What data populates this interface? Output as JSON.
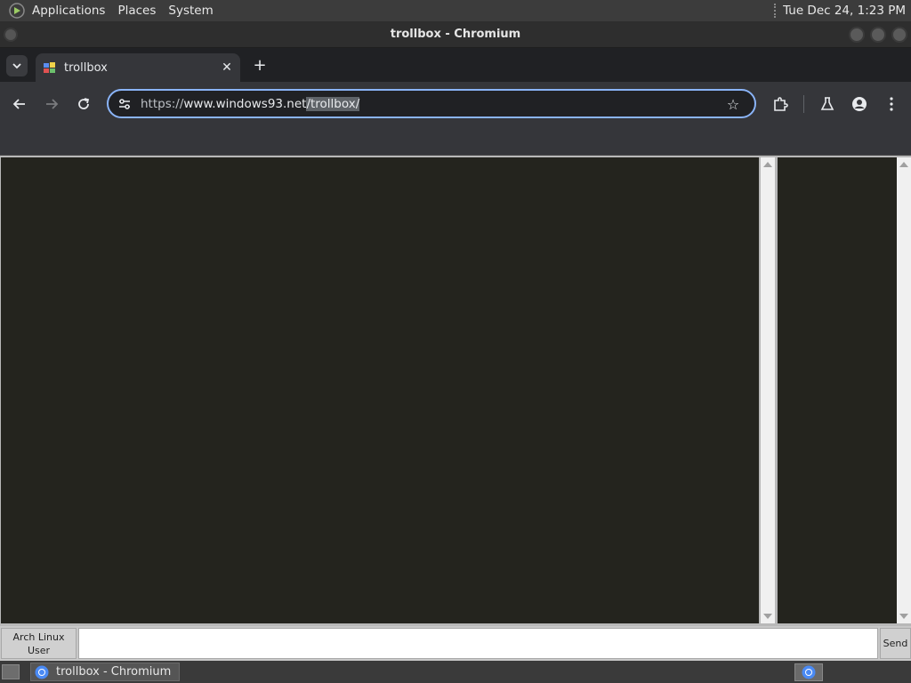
{
  "top_panel": {
    "menus": [
      "Applications",
      "Places",
      "System"
    ],
    "clock": "Tue Dec 24,  1:23 PM"
  },
  "window": {
    "title": "trollbox - Chromium"
  },
  "tabs": [
    {
      "label": "trollbox",
      "active": true
    }
  ],
  "toolbar": {
    "url_scheme": "https://",
    "url_host": "www.windows93.net",
    "url_path": "/trollbox/"
  },
  "page": {
    "nick_button": "Arch Linux User",
    "message_input_value": "",
    "send_label": "Send"
  },
  "taskbar": {
    "task_label": "trollbox - Chromium"
  },
  "icons": {
    "tab_search": "chevron-down-icon",
    "close_tab": "close-icon",
    "new_tab": "plus-icon",
    "back": "arrow-left-icon",
    "forward": "arrow-right-icon",
    "reload": "reload-icon",
    "site_info": "tune-icon",
    "bookmark": "star-icon",
    "extensions": "puzzle-icon",
    "labs": "flask-icon",
    "profile": "person-icon",
    "menu": "kebab-menu-icon"
  },
  "colors": {
    "accent": "#8ab4f8",
    "chat_background": "#24241e"
  }
}
